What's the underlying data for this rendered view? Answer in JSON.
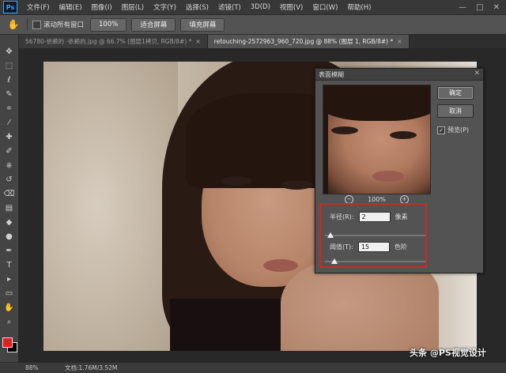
{
  "menubar": {
    "logo": "Ps",
    "items": [
      "文件(F)",
      "编辑(E)",
      "图像(I)",
      "图层(L)",
      "文字(Y)",
      "选择(S)",
      "滤镜(T)",
      "3D(D)",
      "视图(V)",
      "窗口(W)",
      "帮助(H)"
    ],
    "window_controls": [
      "—",
      "□",
      "✕"
    ]
  },
  "options_bar": {
    "scroll_all_label": "滚动所有窗口",
    "zoom_100_label": "100%",
    "fit_screen_label": "适合屏幕",
    "fill_screen_label": "填充屏幕"
  },
  "tabs": [
    {
      "label": "56780-依赖的 -依赖的.jpg @ 66.7% (图层1拷贝, RGB/8#) *",
      "close": "×"
    },
    {
      "label": "retouching-2572963_960_720.jpg @ 88% (图层 1, RGB/8#) *",
      "close": "×"
    }
  ],
  "toolbar": {
    "icons": [
      "move-icon",
      "marquee-icon",
      "lasso-icon",
      "quick-select-icon",
      "crop-icon",
      "eyedropper-icon",
      "healing-icon",
      "brush-icon",
      "clone-stamp-icon",
      "history-brush-icon",
      "eraser-icon",
      "gradient-icon",
      "blur-icon",
      "dodge-icon",
      "pen-icon",
      "type-icon",
      "path-select-icon",
      "rectangle-icon",
      "hand-icon",
      "zoom-icon"
    ],
    "glyphs": [
      "✥",
      "⬚",
      "ℓ",
      "✎",
      "⌗",
      "⁄",
      "✚",
      "✐",
      "⎈",
      "↺",
      "⌫",
      "▤",
      "◆",
      "●",
      "✒",
      "T",
      "▸",
      "▭",
      "✋",
      "⌕"
    ],
    "foreground_color": "#e02020",
    "background_color": "#000000"
  },
  "status_bar": {
    "zoom": "88%",
    "doc": "文档:1.76M/3.52M"
  },
  "dialog": {
    "title": "表面模糊",
    "close": "✕",
    "zoom_out": "−",
    "zoom_level": "100%",
    "zoom_in": "+",
    "ok_label": "确定",
    "cancel_label": "取消",
    "preview_label": "预览(P)",
    "preview_checked": "✓",
    "radius_label": "半径(R):",
    "radius_value": "2",
    "radius_unit": "像素",
    "radius_level": 0.02,
    "threshold_label": "阈值(T):",
    "threshold_value": "15",
    "threshold_unit": "色阶",
    "threshold_level": 0.06
  },
  "highlight_color": "#e02020",
  "watermark": "头条 @PS视觉设计"
}
